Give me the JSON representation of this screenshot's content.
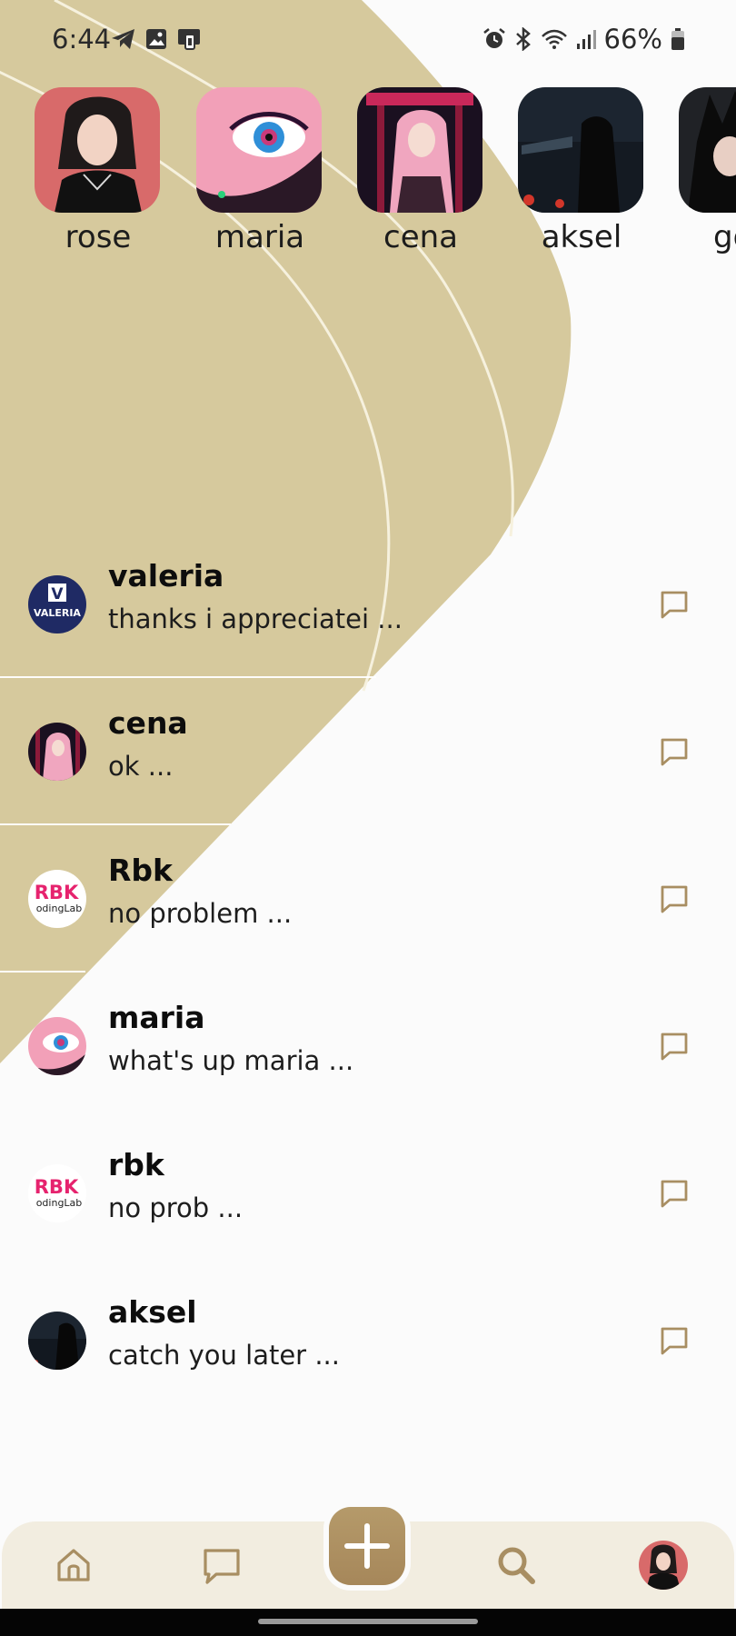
{
  "status_bar": {
    "time": "6:44",
    "left_icons": [
      "telegram-icon",
      "gallery-icon",
      "screen-mirror-icon"
    ],
    "right_icons": [
      "alarm-icon",
      "bluetooth-icon",
      "wifi-icon",
      "signal-icon",
      "battery-icon"
    ],
    "battery": "66%"
  },
  "stories": [
    {
      "name": "rose"
    },
    {
      "name": "maria"
    },
    {
      "name": "cena"
    },
    {
      "name": "aksel"
    },
    {
      "name": "gon"
    }
  ],
  "conversations": [
    {
      "name": "valeria",
      "preview": "thanks i appreciatei ...",
      "avatar_text": "V",
      "avatar_subtext": "VALERIA"
    },
    {
      "name": "cena",
      "preview": "ok ..."
    },
    {
      "name": "Rbk",
      "preview": "no problem ...",
      "avatar_text": "RBK",
      "avatar_subtext": "odingLab"
    },
    {
      "name": "maria",
      "preview": "what's up maria ..."
    },
    {
      "name": "rbk",
      "preview": "no prob ...",
      "avatar_text": "RBK",
      "avatar_subtext": "odingLab"
    },
    {
      "name": "aksel",
      "preview": "catch you later ..."
    }
  ],
  "bottom_nav": {
    "items": [
      "home-icon",
      "chat-icon",
      "add-icon",
      "search-icon",
      "profile-avatar"
    ]
  },
  "colors": {
    "accent_sand": "#d6c99d",
    "accent_brown": "#a88e62",
    "nav_background": "#f2ede0",
    "page_background": "#fbfbfb"
  }
}
